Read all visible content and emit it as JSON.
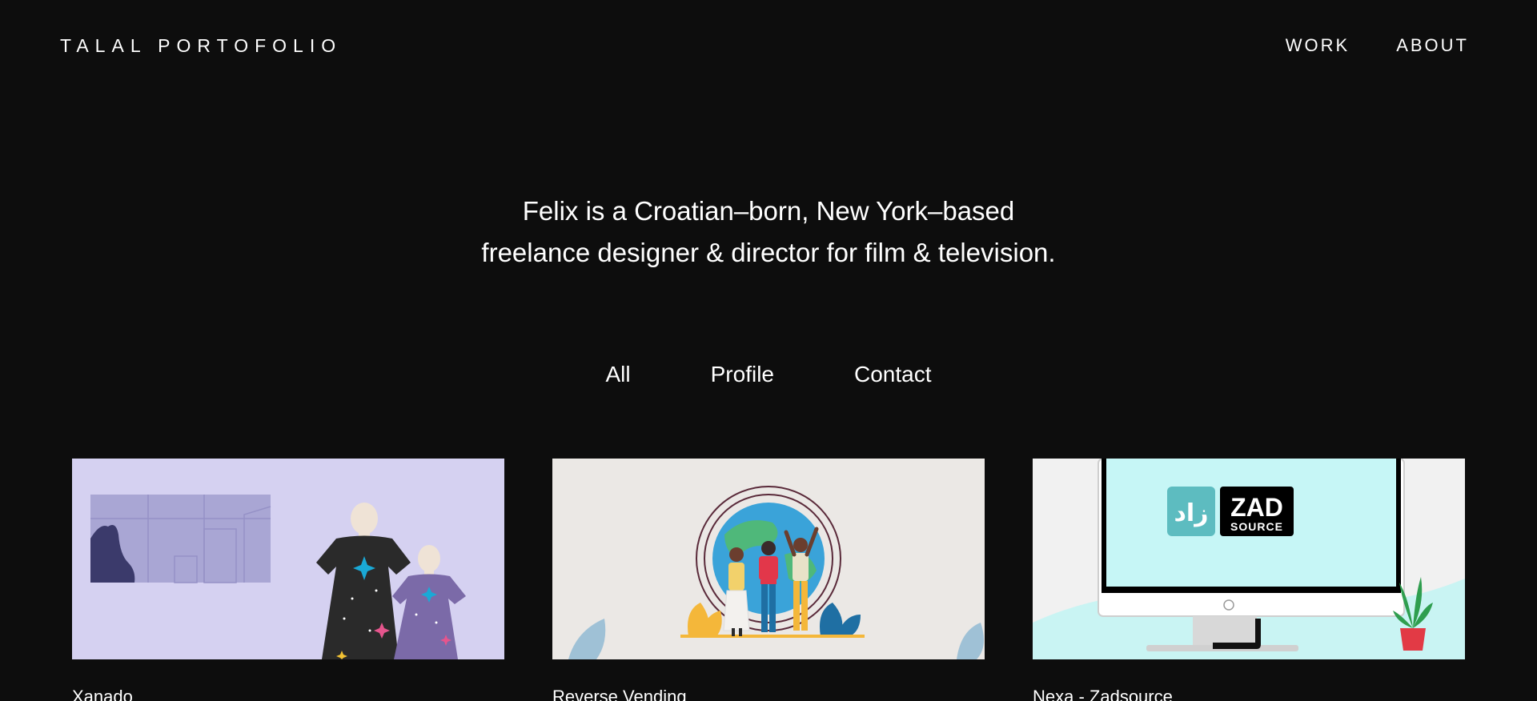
{
  "header": {
    "brand": "TALAL PORTOFOLIO",
    "nav": [
      {
        "label": "WORK"
      },
      {
        "label": "ABOUT"
      }
    ]
  },
  "hero": {
    "line1": "Felix is a Croatian–born, New York–based",
    "line2": "freelance designer & director for film & television."
  },
  "filters": [
    {
      "label": "All"
    },
    {
      "label": "Profile"
    },
    {
      "label": "Contact"
    }
  ],
  "projects": [
    {
      "title": "Xanado"
    },
    {
      "title": "Reverse Vending"
    },
    {
      "title": "Nexa - Zadsource"
    }
  ],
  "logo": {
    "arabic": "زاد",
    "zad": "ZAD",
    "source": "SOURCE"
  },
  "colors": {
    "background": "#0d0d0d",
    "text": "#ffffff",
    "card1_bg": "#d4d0f0",
    "card2_bg": "#ece9e6",
    "card3_screen": "#c6f6f6"
  }
}
